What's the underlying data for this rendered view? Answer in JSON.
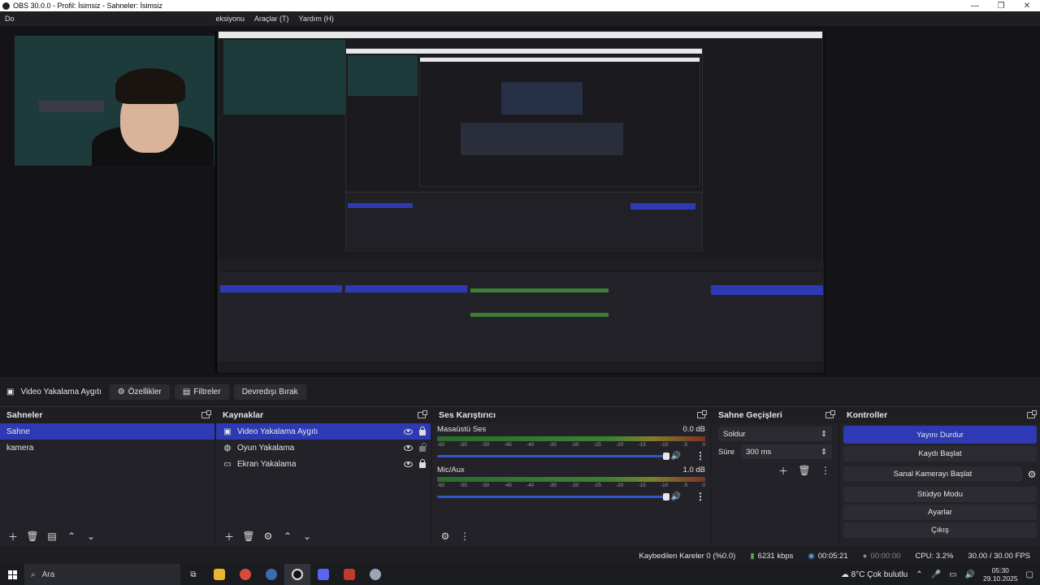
{
  "window": {
    "title": "OBS 30.0.0 - Profil: İsimsiz - Sahneler: İsimsiz",
    "controls": [
      "—",
      "❐",
      "✕"
    ]
  },
  "menu": [
    "Do",
    "eksiyonu",
    "Araçlar (T)",
    "Yardım (H)"
  ],
  "sourcebar": {
    "source_name": "Video Yakalama Aygıtı",
    "properties": "Özellikler",
    "filters": "Filtreler",
    "deactivate": "Devredışı Bırak"
  },
  "scenes": {
    "title": "Sahneler",
    "items": [
      "Sahne",
      "kamera"
    ]
  },
  "sources": {
    "title": "Kaynaklar",
    "items": [
      {
        "label": "Video Yakalama Aygıtı",
        "icon": "camera-icon"
      },
      {
        "label": "Oyun Yakalama",
        "icon": "gamepad-icon"
      },
      {
        "label": "Ekran Yakalama",
        "icon": "monitor-icon"
      }
    ]
  },
  "mixer": {
    "title": "Ses Karıştırıcı",
    "ticks": [
      "-60",
      "-55",
      "-50",
      "-45",
      "-40",
      "-35",
      "-30",
      "-25",
      "-20",
      "-15",
      "-10",
      "-5",
      "0"
    ],
    "channels": [
      {
        "name": "Masaüstü Ses",
        "db": "0.0 dB",
        "volume": 1.0
      },
      {
        "name": "Mic/Aux",
        "db": "1.0 dB",
        "volume": 1.0
      }
    ]
  },
  "transitions": {
    "title": "Sahne Geçişleri",
    "type": "Soldur",
    "duration_label": "Süre",
    "duration_value": "300 ms"
  },
  "controls": {
    "title": "Kontroller",
    "stop_stream": "Yayını Durdur",
    "start_recording": "Kaydı Başlat",
    "virtual_camera": "Sanal Kamerayı Başlat",
    "studio_mode": "Stüdyo Modu",
    "settings": "Ayarlar",
    "exit": "Çıkış"
  },
  "status": {
    "dropped_frames": "Kaybedilen Kareler 0 (%0.0)",
    "bitrate": "6231 kbps",
    "stream_time": "00:05:21",
    "record_time": "00:00:00",
    "cpu": "CPU: 3.2%",
    "fps": "30.00 / 30.00 FPS"
  },
  "taskbar": {
    "search_placeholder": "Ara",
    "weather": "8°C  Çok bulutlu",
    "time": "05:30",
    "date": "29.10.2025"
  },
  "colors": {
    "accent": "#2d3ab4",
    "dock_bg": "#222228",
    "preview_bg": "#141418"
  }
}
